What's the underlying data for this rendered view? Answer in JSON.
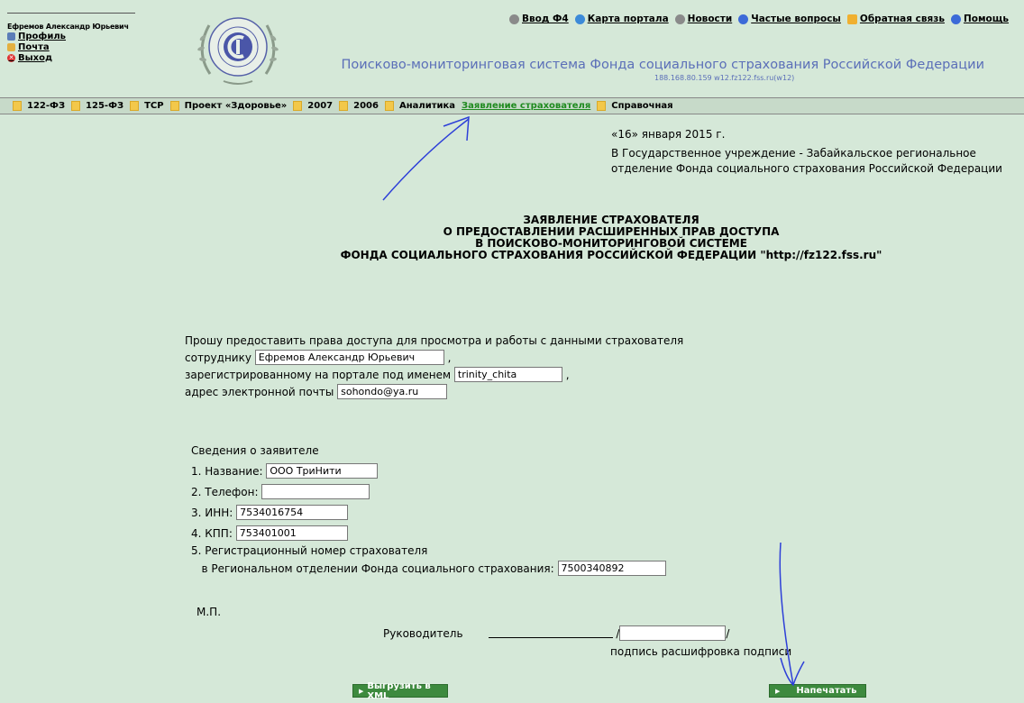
{
  "user": {
    "name": "Ефремов Александр Юрьевич",
    "profile": "Профиль",
    "mail": "Почта",
    "exit": "Выход"
  },
  "topnav": [
    "Ввод Ф4",
    "Карта портала",
    "Новости",
    "Частые вопросы",
    "Обратная связь",
    "Помощь"
  ],
  "system": {
    "title": "Поисково-мониторинговая система Фонда социального страхования Российской Федерации",
    "sub": "188.168.80.159  w12.fz122.fss.ru(w12)"
  },
  "menu": [
    "122-ФЗ",
    "125-ФЗ",
    "ТСР",
    "Проект «Здоровье»",
    "2007",
    "2006",
    "Аналитика",
    "Заявление страхователя",
    "Справочная"
  ],
  "doc": {
    "date": "«16» января 2015 г.",
    "addressee": "В Государственное учреждение - Забайкальское региональное отделение Фонда социального страхования Российской Федерации",
    "title1": "ЗАЯВЛЕНИЕ СТРАХОВАТЕЛЯ",
    "title2": "О ПРЕДОСТАВЛЕНИИ РАСШИРЕННЫХ ПРАВ ДОСТУПА",
    "title3": "В ПОИСКОВО-МОНИТОРИНГОВОЙ СИСТЕМЕ",
    "title4": "ФОНДА СОЦИАЛЬНОГО СТРАХОВАНИЯ РОССИЙСКОЙ ФЕДЕРАЦИИ \"http://fz122.fss.ru\""
  },
  "form": {
    "intro": "Прошу предоставить права доступа для просмотра и работы с данными страхователя",
    "employee_label": "сотруднику",
    "employee_value": "Ефремов Александр Юрьевич",
    "login_label": "зарегистрированному на портале под именем",
    "login_value": "trinity_chita",
    "email_label": "адрес электронной почты",
    "email_value": "sohondo@ya.ru"
  },
  "applicant": {
    "heading": "Сведения о заявителе",
    "name_label": "1. Название:",
    "name_value": "ООО ТриНити",
    "phone_label": "2. Телефон:",
    "phone_value": "",
    "inn_label": "3. ИНН:",
    "inn_value": "7534016754",
    "kpp_label": "4. КПП:",
    "kpp_value": "753401001",
    "reg_label1": "5. Регистрационный номер страхователя",
    "reg_label2": "в Региональном отделении Фонда социального страхования:",
    "reg_value": "7500340892"
  },
  "sign": {
    "mp": "М.П.",
    "head": "Руководитель",
    "caption": "подпись расшифровка подписи"
  },
  "buttons": {
    "xml": "Выгрузить в XML",
    "print": "Напечатать"
  }
}
